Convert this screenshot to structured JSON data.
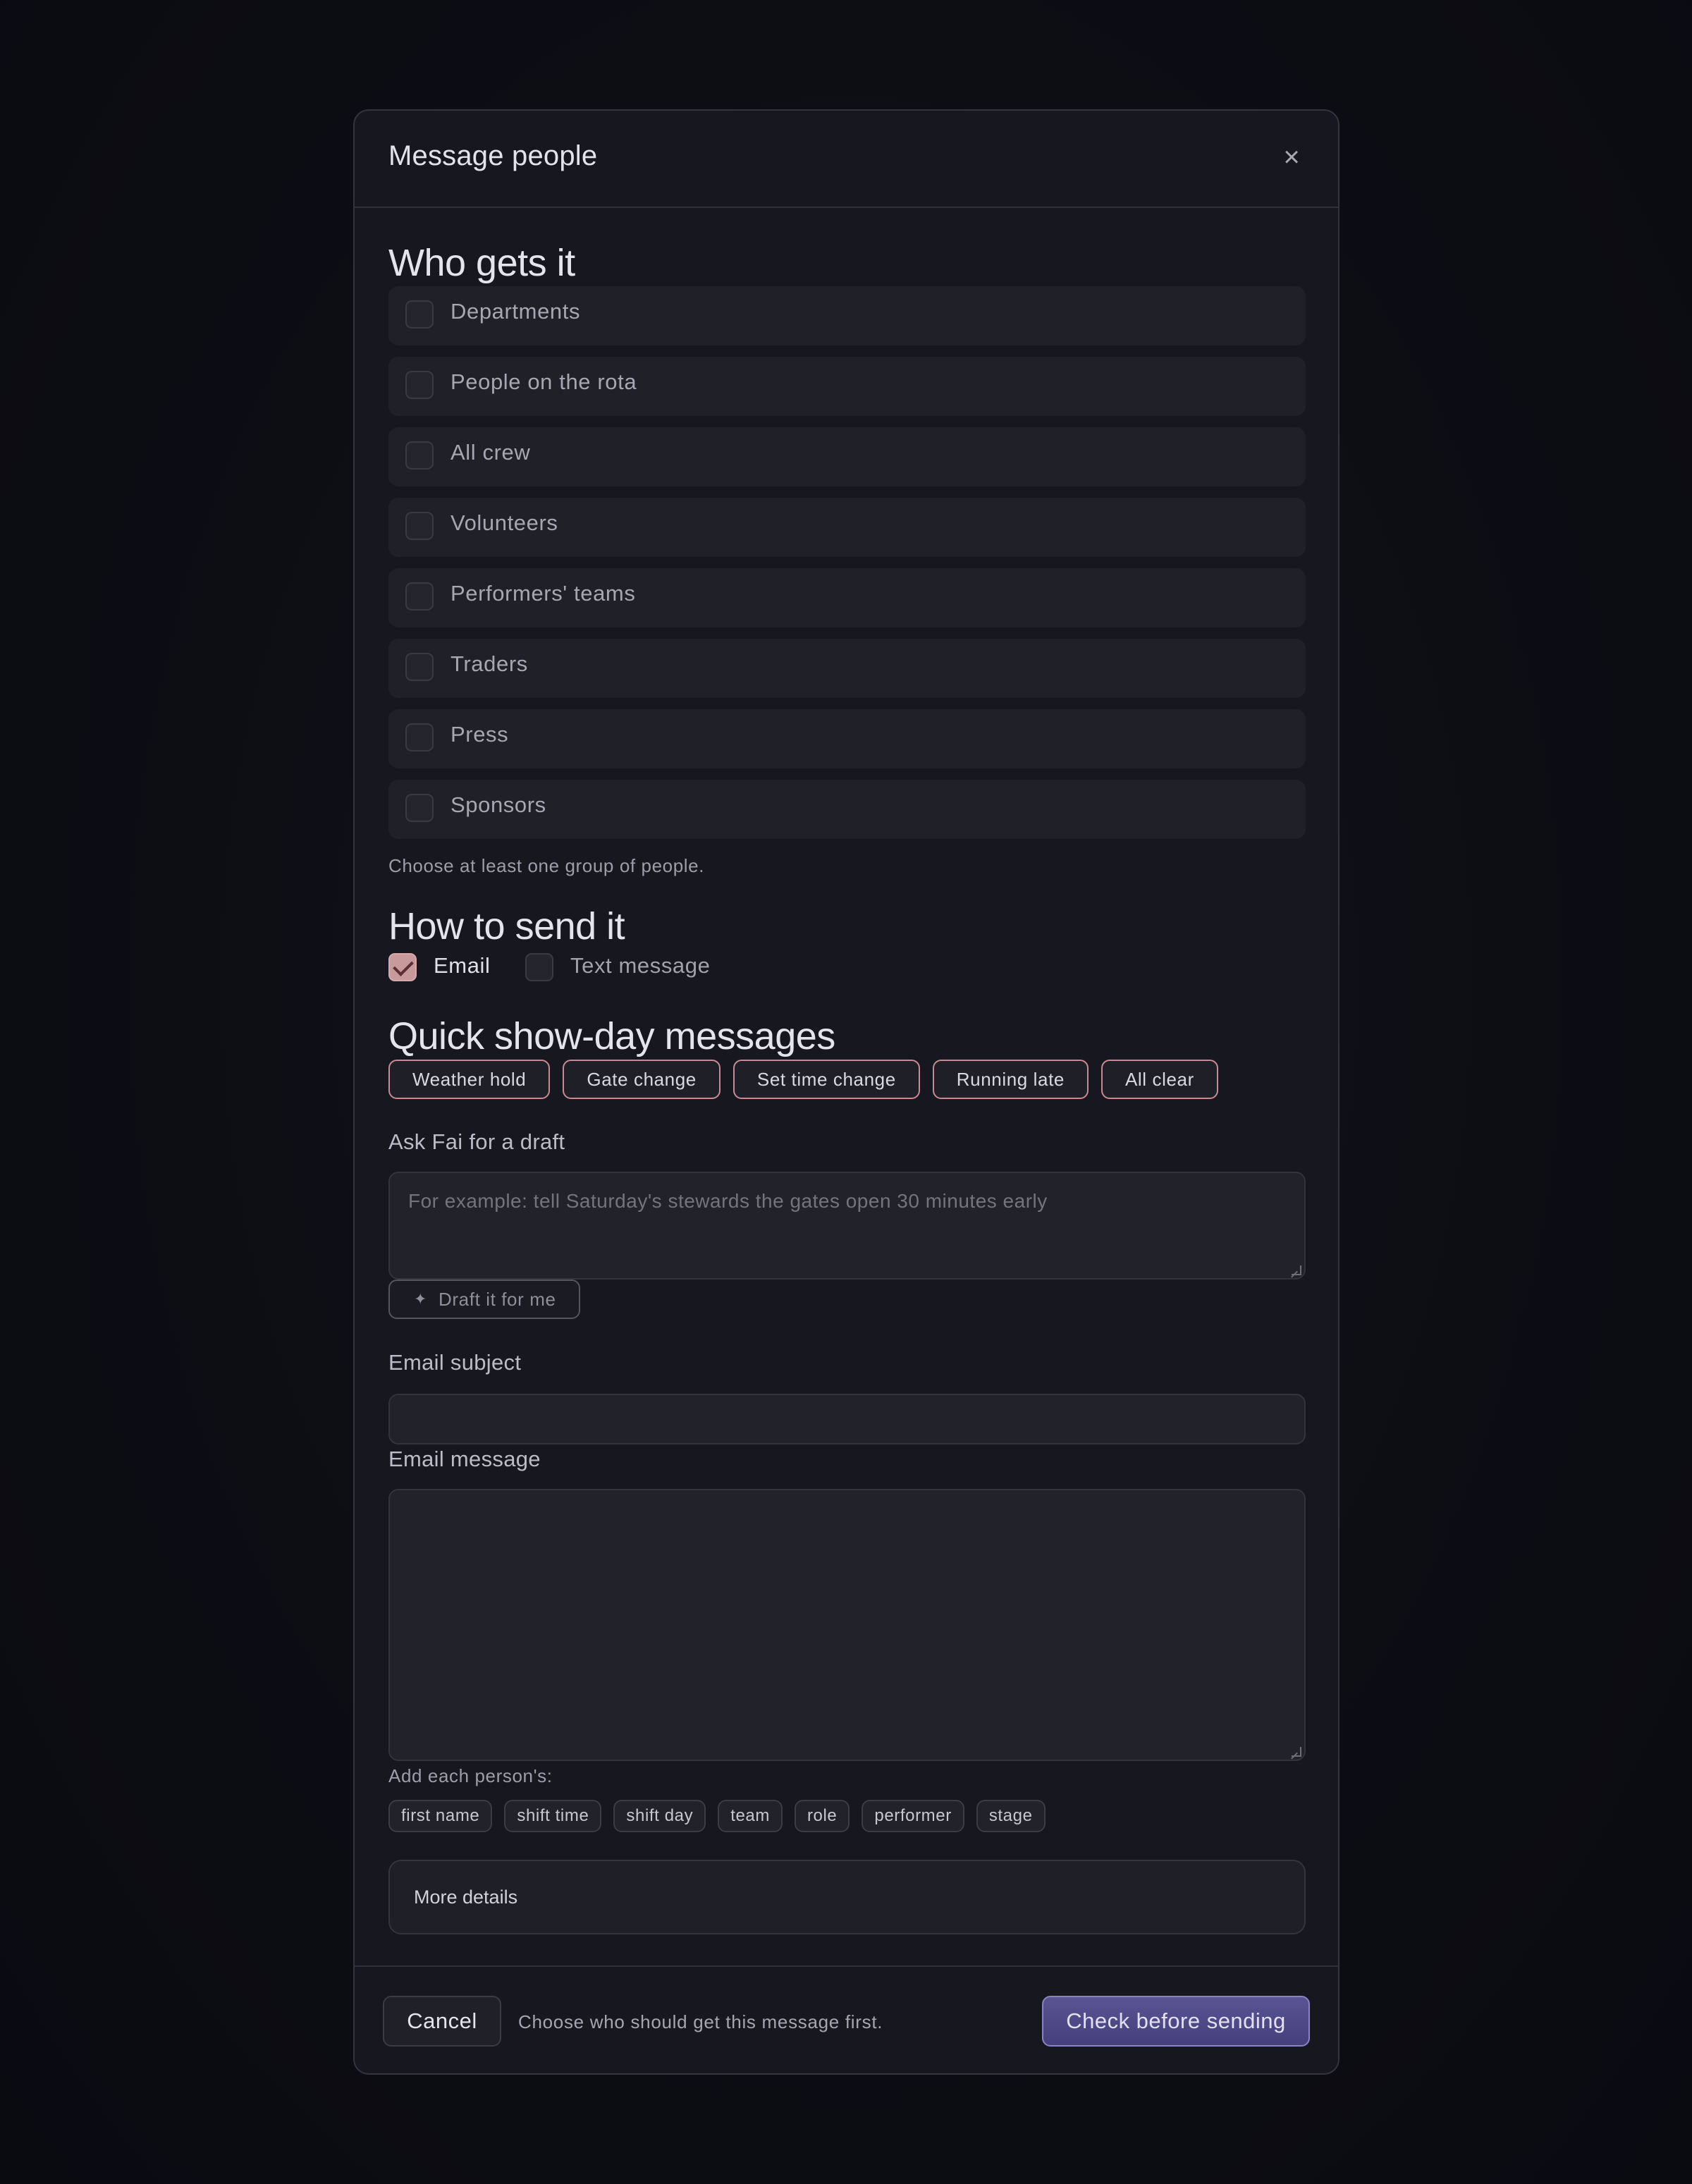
{
  "dialog": {
    "title": "Message people",
    "close_icon": "×"
  },
  "recipients": {
    "title": "Who gets it",
    "groups": [
      {
        "label": "Departments",
        "checked": false
      },
      {
        "label": "People on the rota",
        "checked": false
      },
      {
        "label": "All crew",
        "checked": false
      },
      {
        "label": "Volunteers",
        "checked": false
      },
      {
        "label": "Performers' teams",
        "checked": false
      },
      {
        "label": "Traders",
        "checked": false
      },
      {
        "label": "Press",
        "checked": false
      },
      {
        "label": "Sponsors",
        "checked": false
      }
    ],
    "hint": "Choose at least one group of people."
  },
  "channels": {
    "title": "How to send it",
    "email": {
      "label": "Email",
      "checked": true
    },
    "sms": {
      "label": "Text message",
      "checked": false
    }
  },
  "quick": {
    "title": "Quick show-day messages",
    "chips": [
      "Weather hold",
      "Gate change",
      "Set time change",
      "Running late",
      "All clear"
    ]
  },
  "draft": {
    "label": "Ask Fai for a draft",
    "placeholder": "For example: tell Saturday's stewards the gates open 30 minutes early",
    "button_icon": "✦",
    "button_label": "Draft it for me"
  },
  "email": {
    "subject_label": "Email subject",
    "subject_value": "",
    "message_label": "Email message",
    "message_value": ""
  },
  "personalize": {
    "label": "Add each person's:",
    "tokens": [
      "first name",
      "shift time",
      "shift day",
      "team",
      "role",
      "performer",
      "stage"
    ]
  },
  "more_details": {
    "label": "More details"
  },
  "footer": {
    "cancel_label": "Cancel",
    "hint": "Choose who should get this message first.",
    "send_label": "Check before sending"
  },
  "colors": {
    "accent": "#4a4382",
    "chip_border": "#c98b91",
    "checked_fill": "#c99a9c"
  }
}
